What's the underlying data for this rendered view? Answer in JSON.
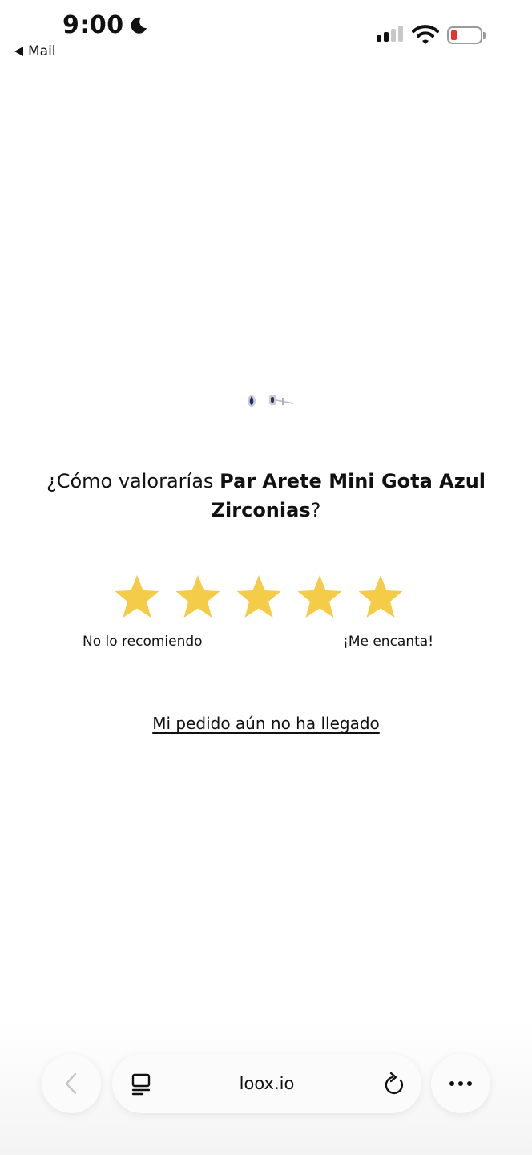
{
  "status_bar": {
    "time": "9:00",
    "back_app": "Mail"
  },
  "review": {
    "question_prefix": "¿Cómo valorarías ",
    "product_name": "Par Arete Mini Gota Azul Zirconias",
    "question_suffix": "?",
    "star_color": "#F4CC47",
    "star_count": 5,
    "label_low": "No lo recomiendo",
    "label_high": "¡Me encanta!",
    "not_arrived_link": "Mi pedido aún no ha llegado"
  },
  "browser": {
    "url": "loox.io"
  }
}
